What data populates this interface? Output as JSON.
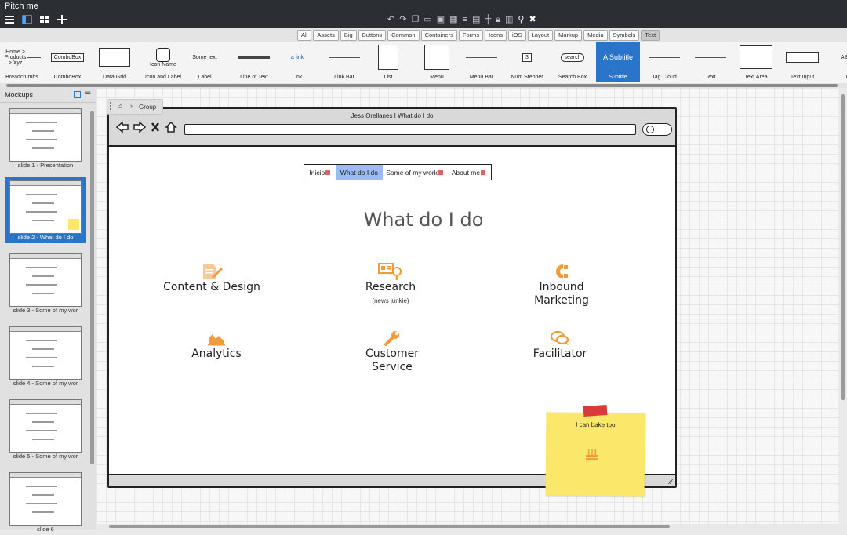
{
  "app": {
    "title": "Pitch me"
  },
  "categories": [
    "All",
    "Assets",
    "Big",
    "Buttons",
    "Common",
    "Containers",
    "Forms",
    "Icons",
    "iOS",
    "Layout",
    "Markup",
    "Media",
    "Symbols",
    "Text"
  ],
  "active_category": "Text",
  "library": [
    {
      "label": "Breadcrumbs",
      "preview": "Home > Products > Xyz"
    },
    {
      "label": "ComboBox",
      "preview": "ComboBox"
    },
    {
      "label": "Data Grid",
      "preview": ""
    },
    {
      "label": "Icon and Label",
      "preview": "Icon Name"
    },
    {
      "label": "Label",
      "preview": "Some text"
    },
    {
      "label": "Line of Text",
      "preview": ""
    },
    {
      "label": "Link",
      "preview": "a link"
    },
    {
      "label": "Link Bar",
      "preview": ""
    },
    {
      "label": "List",
      "preview": ""
    },
    {
      "label": "Menu",
      "preview": ""
    },
    {
      "label": "Menu Bar",
      "preview": ""
    },
    {
      "label": "Num.Stepper",
      "preview": "3"
    },
    {
      "label": "Search Box",
      "preview": "search"
    },
    {
      "label": "Subtitle",
      "preview": "A Subtitle"
    },
    {
      "label": "Tag Cloud",
      "preview": ""
    },
    {
      "label": "Text",
      "preview": ""
    },
    {
      "label": "Text Area",
      "preview": ""
    },
    {
      "label": "Text Input",
      "preview": ""
    },
    {
      "label": "Ti",
      "preview": "A Big"
    }
  ],
  "sidebar": {
    "title": "Mockups",
    "slides": [
      {
        "label": "slide 1 - Presentation"
      },
      {
        "label": "slide 2 - What do I do"
      },
      {
        "label": "slide 3 - Some of my wor"
      },
      {
        "label": "slide 4 - Some of my wor"
      },
      {
        "label": "slide 5 - Some of my wor"
      },
      {
        "label": "slide 6"
      }
    ],
    "active_index": 1
  },
  "breadcrumb": {
    "label": "Group"
  },
  "browser": {
    "title": "Jess Orellanes I What do I do"
  },
  "menu": {
    "items": [
      {
        "label": "Inicio"
      },
      {
        "label": "What do I do"
      },
      {
        "label": "Some of my work"
      },
      {
        "label": "About me"
      }
    ],
    "active_index": 1
  },
  "page": {
    "heading": "What do I do"
  },
  "services": [
    {
      "name": "Content & Design",
      "sub": "",
      "icon": "design-icon"
    },
    {
      "name": "Research",
      "sub": "(news junkie)",
      "icon": "research-icon"
    },
    {
      "name": "Inbound\nMarketing",
      "sub": "",
      "icon": "inbound-icon"
    },
    {
      "name": "Analytics",
      "sub": "",
      "icon": "analytics-icon"
    },
    {
      "name": "Customer\nService",
      "sub": "",
      "icon": "wrench-icon"
    },
    {
      "name": "Facilitator",
      "sub": "",
      "icon": "chat-icon"
    }
  ],
  "note": {
    "text": "I can bake too",
    "icon": "cake-icon"
  },
  "colors": {
    "accent": "#f39a3a",
    "selection": "#2a74c9",
    "menu_active": "#9bbbf2",
    "note": "#fbe76a",
    "tape": "#d93a3a"
  }
}
